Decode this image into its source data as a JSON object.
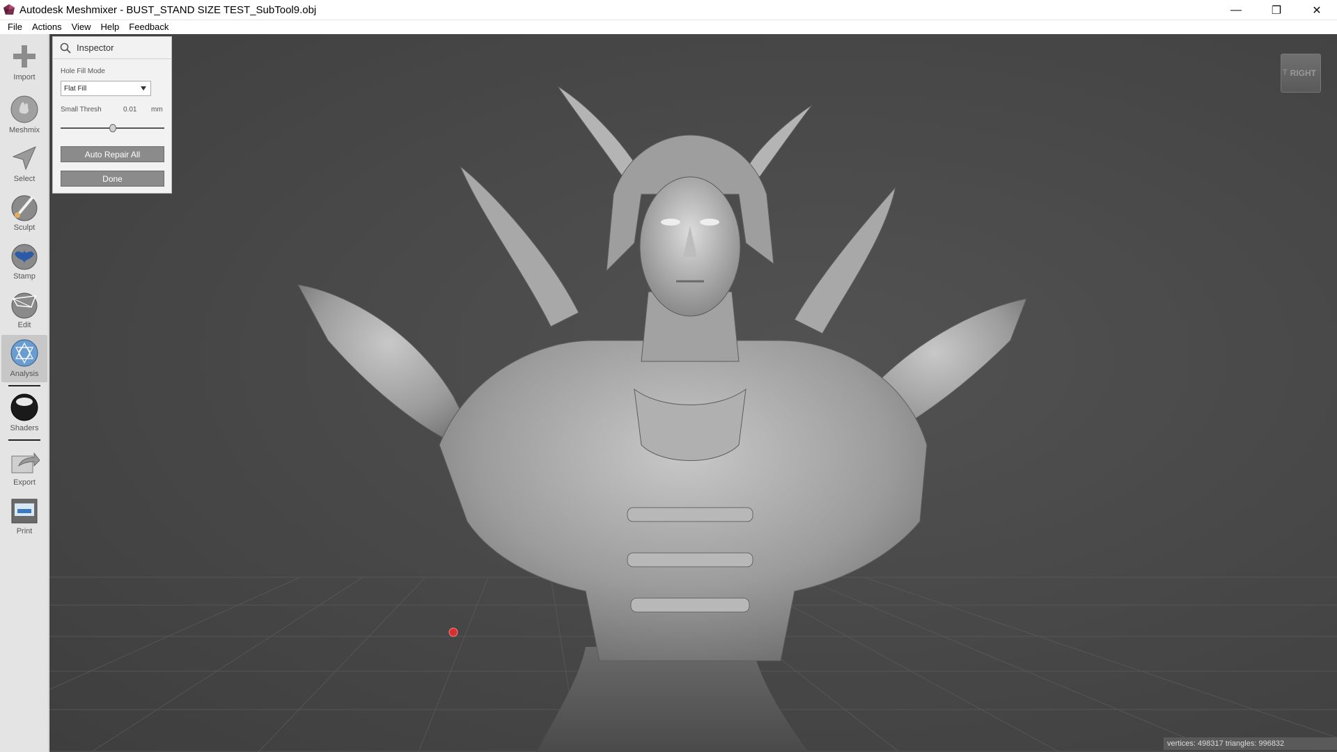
{
  "window": {
    "title": "Autodesk Meshmixer - BUST_STAND SIZE TEST_SubTool9.obj",
    "minimize_glyph": "—",
    "maximize_glyph": "❐",
    "close_glyph": "✕"
  },
  "menu": [
    "File",
    "Actions",
    "View",
    "Help",
    "Feedback"
  ],
  "toolbar": {
    "tools": [
      {
        "label": "Import",
        "icon": "plus-icon"
      },
      {
        "label": "Meshmix",
        "icon": "bunny-sphere-icon"
      },
      {
        "label": "Select",
        "icon": "arrow-cursor-icon"
      },
      {
        "label": "Sculpt",
        "icon": "brush-sphere-icon"
      },
      {
        "label": "Stamp",
        "icon": "stamp-sphere-icon"
      },
      {
        "label": "Edit",
        "icon": "edit-sphere-icon"
      },
      {
        "label": "Analysis",
        "icon": "analysis-sphere-icon",
        "active": true
      },
      {
        "label": "Shaders",
        "icon": "shaders-sphere-icon"
      },
      {
        "label": "Export",
        "icon": "export-icon"
      },
      {
        "label": "Print",
        "icon": "printer-icon"
      }
    ]
  },
  "inspector": {
    "title": "Inspector",
    "hole_fill_mode_label": "Hole Fill Mode",
    "hole_fill_mode_value": "Flat Fill",
    "small_thresh_label": "Small Thresh",
    "small_thresh_value": "0.01",
    "small_thresh_unit": "mm",
    "small_thresh_slider_fraction": 0.5,
    "auto_repair_label": "Auto Repair All",
    "done_label": "Done"
  },
  "viewcube": {
    "face_label": "RIGHT",
    "side_fragment": "T"
  },
  "status": {
    "text": "vertices: 498317 triangles: 996832"
  },
  "colors": {
    "viewport_bg": "#474747",
    "mesh": "#9a9a9a",
    "button_bg": "#8b8b8b",
    "pivot_marker": "#d83030"
  }
}
